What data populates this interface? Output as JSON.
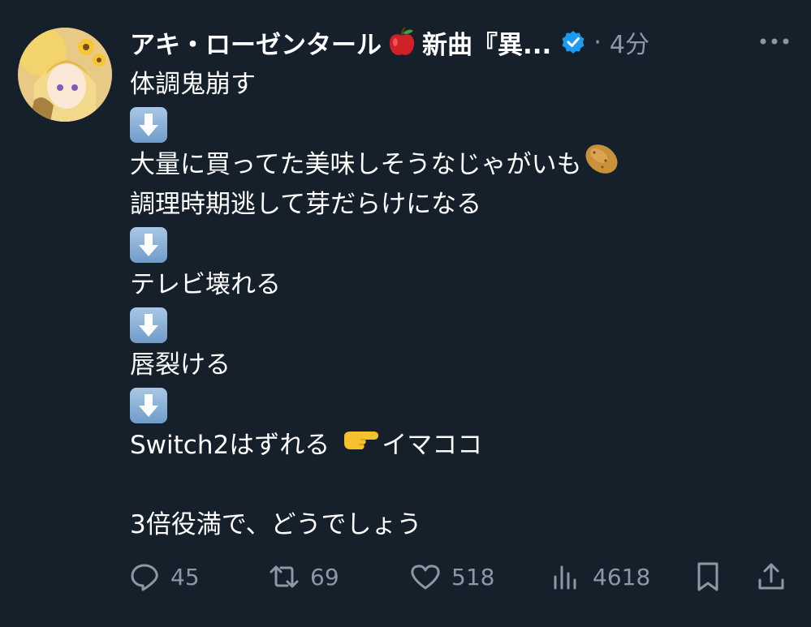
{
  "tweet": {
    "author_name": "アキ・ローゼンタール",
    "author_name_tail": "新曲『異...",
    "time_separator": "·",
    "time": "4分",
    "lines": [
      "体調鬼崩す",
      "大量に買ってた美味しそうなじゃがいも",
      "調理時期逃して芽だらけになる",
      "テレビ壊れる",
      "唇裂ける",
      "Switch2はずれる",
      "イマココ",
      "3倍役満で、どうでしょう"
    ],
    "actions": {
      "replies": "45",
      "retweets": "69",
      "likes": "518",
      "views": "4618"
    }
  },
  "icons": [
    "avatar-image",
    "apple-emoji",
    "verified-badge-icon",
    "more-icon",
    "down-arrow-emoji",
    "potato-emoji",
    "pointing-hand-emoji",
    "reply-icon",
    "retweet-icon",
    "like-icon",
    "views-icon",
    "bookmark-icon",
    "share-icon"
  ],
  "colors": {
    "background": "#15202b",
    "text": "#ffffff",
    "muted": "#8b98a5",
    "verified": "#1d9bf0"
  }
}
